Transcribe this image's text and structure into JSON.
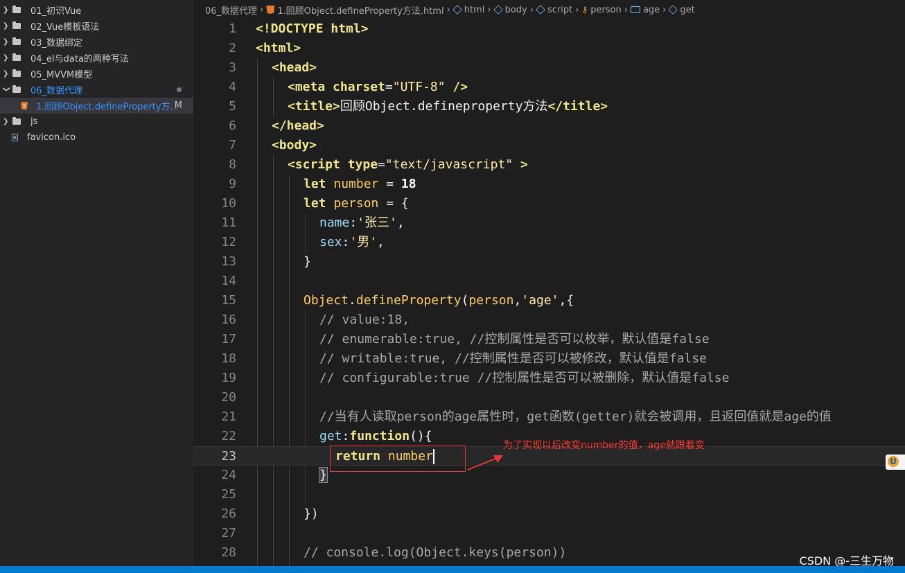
{
  "sidebar": {
    "items": [
      {
        "label": "01_初识Vue",
        "type": "folder"
      },
      {
        "label": "02_Vue模板语法",
        "type": "folder"
      },
      {
        "label": "03_数据绑定",
        "type": "folder"
      },
      {
        "label": "04_el与data的两种写法",
        "type": "folder"
      },
      {
        "label": "05_MVVM模型",
        "type": "folder"
      },
      {
        "label": "06_数据代理",
        "type": "folder-open"
      },
      {
        "label": "1.回顾Object.defineProperty方...",
        "type": "html-file",
        "badge": "M"
      },
      {
        "label": "js",
        "type": "folder"
      },
      {
        "label": "favicon.ico",
        "type": "file"
      }
    ]
  },
  "breadcrumb": {
    "items": [
      "06_数据代理",
      "1.回顾Object.defineProperty方法.html",
      "html",
      "body",
      "script",
      "person",
      "age",
      "get"
    ]
  },
  "editor": {
    "current_line": 23,
    "lines": [
      {
        "n": "1"
      },
      {
        "n": "2"
      },
      {
        "n": "3"
      },
      {
        "n": "4"
      },
      {
        "n": "5"
      },
      {
        "n": "6"
      },
      {
        "n": "7"
      },
      {
        "n": "8"
      },
      {
        "n": "9"
      },
      {
        "n": "10"
      },
      {
        "n": "11"
      },
      {
        "n": "12"
      },
      {
        "n": "13"
      },
      {
        "n": "14"
      },
      {
        "n": "15"
      },
      {
        "n": "16"
      },
      {
        "n": "17"
      },
      {
        "n": "18"
      },
      {
        "n": "19"
      },
      {
        "n": "20"
      },
      {
        "n": "21"
      },
      {
        "n": "22"
      },
      {
        "n": "23"
      },
      {
        "n": "24"
      },
      {
        "n": "25"
      },
      {
        "n": "26"
      },
      {
        "n": "27"
      },
      {
        "n": "28"
      }
    ],
    "code": {
      "l1": "<!DOCTYPE html>",
      "l2": "<html>",
      "l3": "<head>",
      "l4a": "<meta",
      "l4b": " charset",
      "l4c": "=",
      "l4d": "\"UTF-8\"",
      "l4e": " />",
      "l5a": "<title>",
      "l5b": "回顾Object.defineproperty方法",
      "l5c": "</title>",
      "l6": "</head>",
      "l7": "<body>",
      "l8a": "<script",
      "l8b": " type",
      "l8c": "=",
      "l8d": "\"text/javascript\"",
      "l8e": " >",
      "l9a": "let",
      "l9b": " number",
      "l9c": " = ",
      "l9d": "18",
      "l10a": "let",
      "l10b": " person",
      "l10c": " = {",
      "l11a": "name",
      "l11b": ":",
      "l11c": "'张三'",
      "l11d": ",",
      "l12a": "sex",
      "l12b": ":",
      "l12c": "'男'",
      "l12d": ",",
      "l13": "}",
      "l15a": "Object",
      "l15b": ".",
      "l15c": "defineProperty",
      "l15d": "(",
      "l15e": "person",
      "l15f": ",",
      "l15g": "'age'",
      "l15h": ",{",
      "l16": "// value:18,",
      "l17": "// enumerable:true, //控制属性是否可以枚举，默认值是false",
      "l18": "// writable:true, //控制属性是否可以被修改，默认值是false",
      "l19": "// configurable:true //控制属性是否可以被删除，默认值是false",
      "l21": "//当有人读取person的age属性时，get函数(getter)就会被调用，且返回值就是age的值",
      "l22a": "get",
      "l22b": ":",
      "l22c": "function",
      "l22d": "(){",
      "l23a": "return",
      "l23b": " number",
      "l24": "}",
      "l26": "})",
      "l28": "// console.log(Object.keys(person))"
    }
  },
  "annotation": {
    "text": "为了实现以后改变number的值，age就跟着变",
    "color": "#ff3b30"
  },
  "watermark": "CSDN @-三生万物",
  "colors": {
    "accent": "#007acc",
    "tag": "#f0e68c",
    "string": "#ffeaa7",
    "comment": "#a8a8a8",
    "annotation": "#e8333a"
  }
}
